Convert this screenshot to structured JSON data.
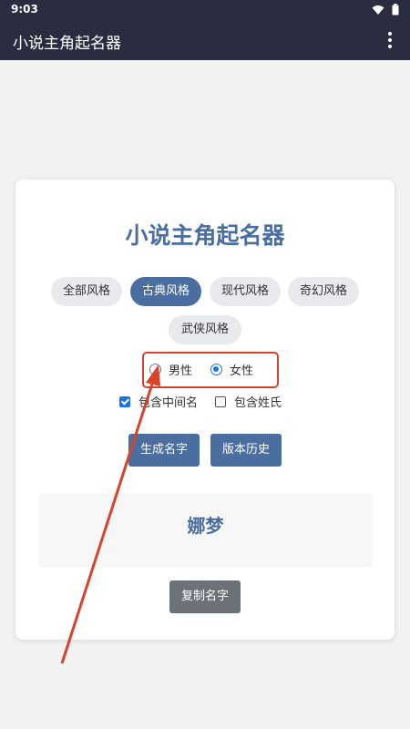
{
  "status_bar": {
    "time": "9:03",
    "icons": [
      "wifi-icon",
      "battery-icon"
    ]
  },
  "app_bar": {
    "title": "小说主角起名器",
    "menu_icon": "more-vert-icon"
  },
  "card": {
    "title": "小说主角起名器",
    "styles": [
      {
        "label": "全部风格",
        "active": false
      },
      {
        "label": "古典风格",
        "active": true
      },
      {
        "label": "现代风格",
        "active": false
      },
      {
        "label": "奇幻风格",
        "active": false
      },
      {
        "label": "武侠风格",
        "active": false
      }
    ],
    "gender": {
      "male_label": "男性",
      "female_label": "女性",
      "selected": "女性"
    },
    "options": {
      "middle_name_label": "包含中间名",
      "middle_name_checked": true,
      "surname_label": "包含姓氏",
      "surname_checked": false
    },
    "buttons": {
      "generate_label": "生成名字",
      "history_label": "版本历史",
      "copy_label": "复制名字"
    },
    "result": "娜梦"
  },
  "colors": {
    "accent": "#4a6ea0",
    "app_bar": "#2a2c40",
    "annotation": "#d8432c",
    "radio_checkbox": "#1a73e8"
  }
}
